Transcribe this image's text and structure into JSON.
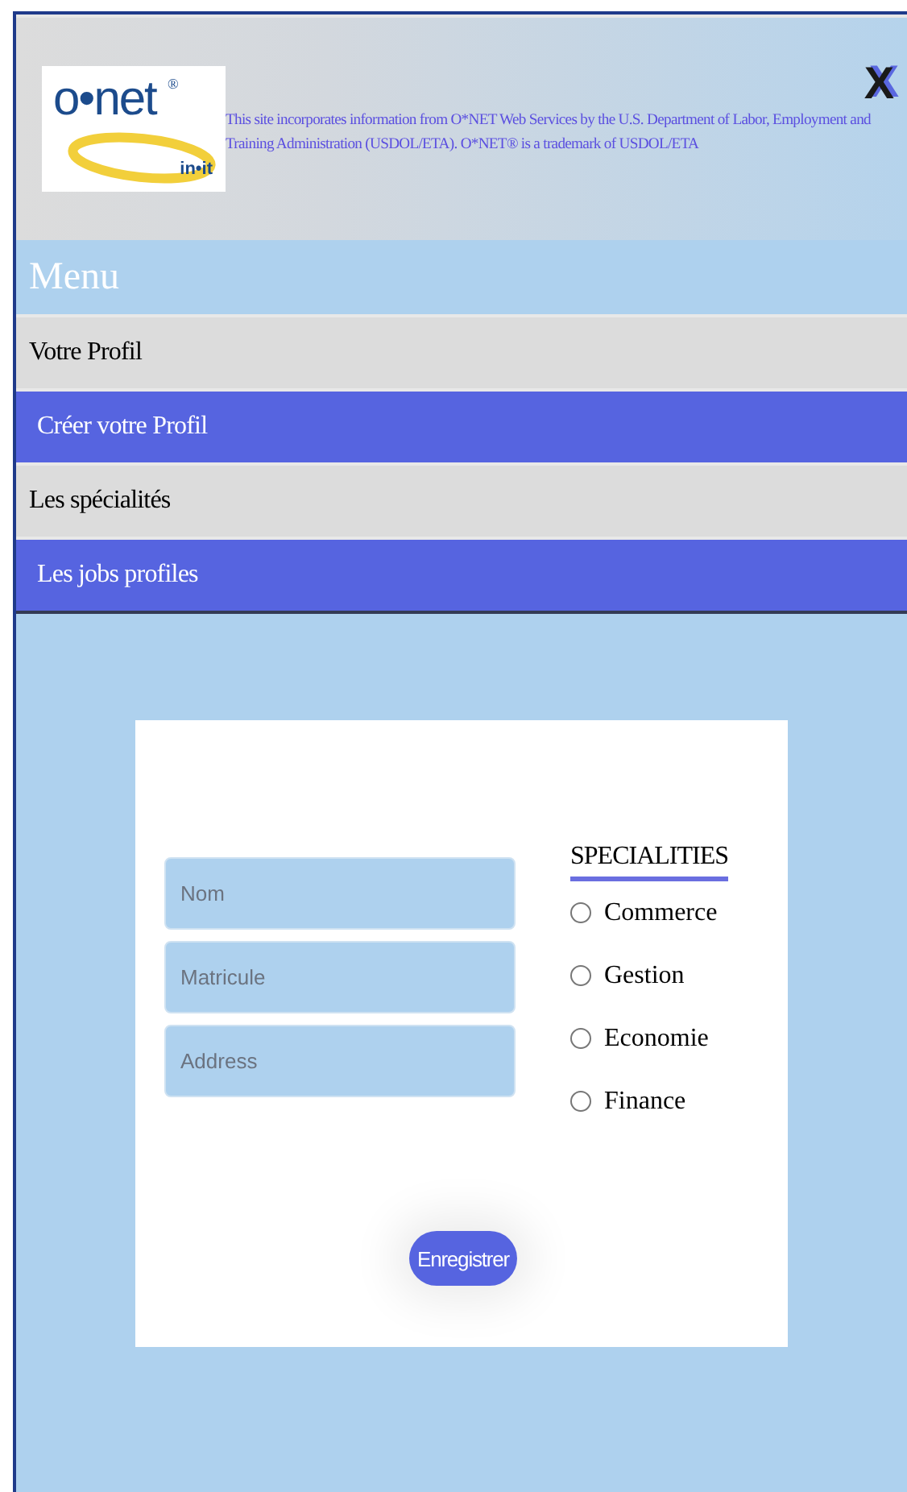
{
  "header": {
    "logo": {
      "word": "o•net",
      "mark": "®",
      "tagline": "in•it"
    },
    "notice": "This site incorporates information from O*NET Web Services by the U.S. Department of Labor, Employment and Training Administration (USDOL/ETA). O*NET® is a trademark of USDOL/ETA",
    "close": "X"
  },
  "menu": {
    "title": "Menu",
    "items": [
      {
        "label": "Votre Profil",
        "kind": "plain"
      },
      {
        "label": "Créer votre Profil",
        "kind": "highlight"
      },
      {
        "label": "Les spécialités",
        "kind": "plain"
      },
      {
        "label": "Les jobs profiles",
        "kind": "highlight"
      }
    ]
  },
  "form": {
    "fields": [
      {
        "placeholder": "Nom"
      },
      {
        "placeholder": "Matricule"
      },
      {
        "placeholder": "Address"
      }
    ],
    "specialities": {
      "title": "SPECIALITIES",
      "options": [
        {
          "label": "Commerce",
          "checked": false
        },
        {
          "label": "Gestion",
          "checked": false
        },
        {
          "label": "Economie",
          "checked": false
        },
        {
          "label": "Finance",
          "checked": false
        }
      ]
    },
    "submit": "Enregistrer"
  }
}
